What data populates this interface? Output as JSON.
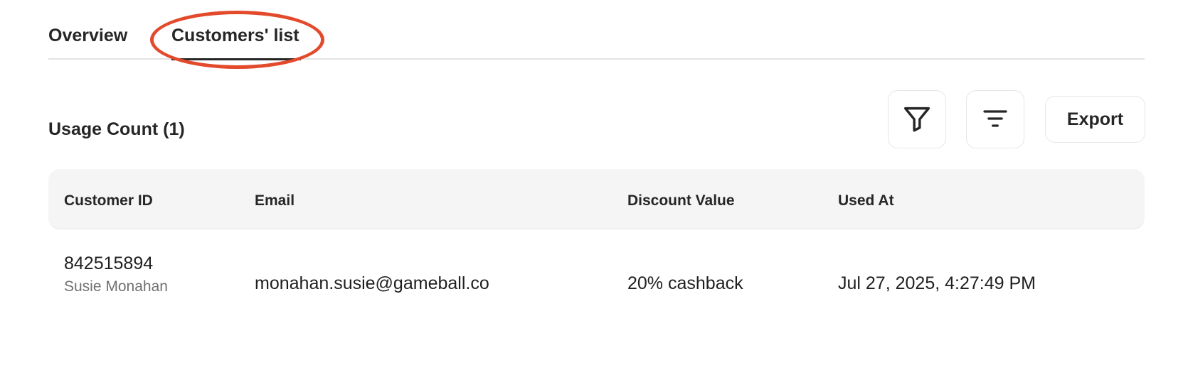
{
  "tabs": [
    {
      "label": "Overview",
      "active": false
    },
    {
      "label": "Customers' list",
      "active": true
    }
  ],
  "section": {
    "title": "Usage Count (1)"
  },
  "toolbar": {
    "filter_icon": "filter-icon",
    "sort_icon": "sort-lines-icon",
    "export_label": "Export"
  },
  "table": {
    "headers": [
      "Customer ID",
      "Email",
      "Discount Value",
      "Used At"
    ],
    "rows": [
      {
        "customer_id": "842515894",
        "customer_name": "Susie Monahan",
        "email": "monahan.susie@gameball.co",
        "discount_value": "20% cashback",
        "used_at": "Jul 27, 2025, 4:27:49 PM"
      }
    ]
  },
  "colors": {
    "highlight": "#e34a2c",
    "text": "#262626",
    "muted": "#707070",
    "header_bg": "#f5f5f5",
    "border": "#e3e3e3"
  }
}
